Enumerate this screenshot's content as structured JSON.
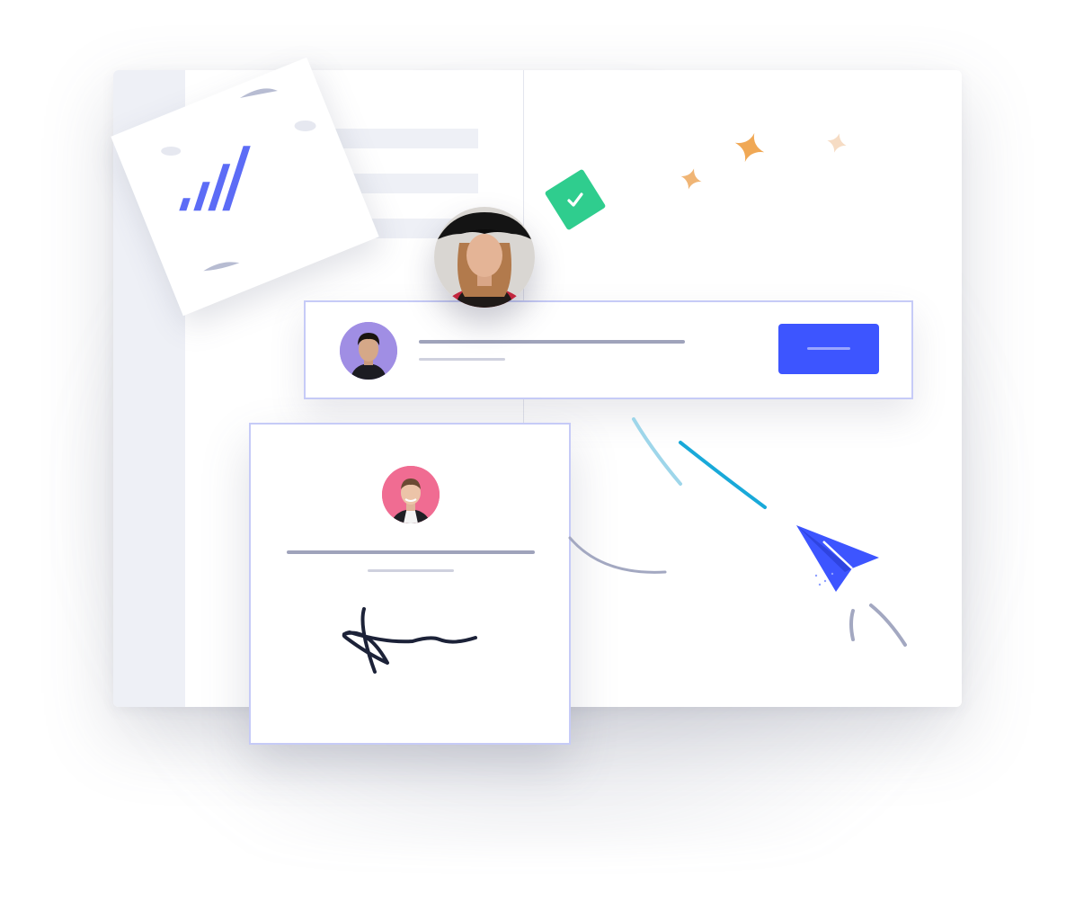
{
  "colors": {
    "accent": "#3d55ff",
    "chart_bars": "#5c6cf6",
    "success": "#2fcd8e",
    "sparkle": "#f0a855",
    "sparkle_light": "#f6dcc4",
    "line_placeholder": "#9fa3bb",
    "line_placeholder_light": "#cfd1de",
    "card_border": "#c6cbf7",
    "signature_ink": "#1c2238",
    "streak_blue": "#19a9d9"
  },
  "icons": {
    "chart": "bar-chart-icon",
    "check": "check-icon",
    "send": "paper-plane-icon",
    "sparkle": "sparkle-icon",
    "signature": "signature-icon"
  },
  "chart_card": {
    "bar_count": 4
  }
}
